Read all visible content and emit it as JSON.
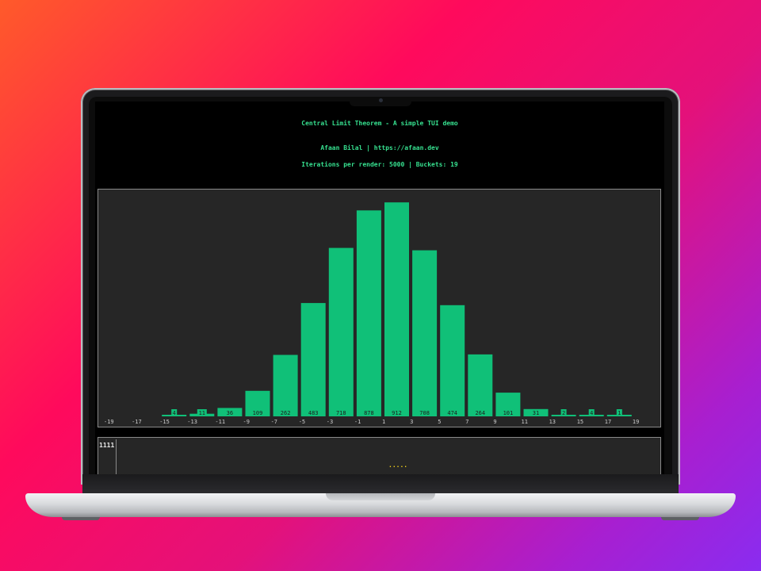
{
  "header": {
    "title": "Central Limit Theorem - A simple TUI demo",
    "author_line": "Afaan Bilal | https://afaan.dev",
    "stats_line": "Iterations per render: 5000 | Buckets: 19"
  },
  "chart_data": {
    "type": "bar",
    "categories": [
      "-19",
      "-17",
      "-15",
      "-13",
      "-11",
      "-9",
      "-7",
      "-5",
      "-3",
      "-1",
      "1",
      "3",
      "5",
      "7",
      "9",
      "11",
      "13",
      "15",
      "17",
      "19"
    ],
    "values": [
      0,
      0,
      4,
      11,
      36,
      109,
      262,
      483,
      718,
      878,
      912,
      708,
      474,
      264,
      101,
      31,
      2,
      4,
      1,
      0
    ],
    "value_labels": [
      "",
      "",
      "4",
      "11",
      "36",
      "109",
      "262",
      "483",
      "718",
      "878",
      "912",
      "708",
      "474",
      "264",
      "101",
      "31",
      "2",
      "4",
      "1",
      ""
    ],
    "axis_tick_labels": [
      "-19",
      "-17",
      "-15",
      "-13",
      "-11",
      "-9",
      "-7",
      "-5",
      "-3",
      "-1",
      "1",
      "3",
      "5",
      "7",
      "9",
      "11",
      "13",
      "15",
      "17",
      "19"
    ],
    "ylim": [
      0,
      950
    ],
    "bar_color": "#10c078",
    "label_color": "#1d1d1d",
    "axis_label_color": "#cfcfcf"
  },
  "log_panel": {
    "count": "1111",
    "sparkline": "....."
  },
  "colors": {
    "header_text": "#36e08f",
    "panel_bg": "#262626",
    "panel_border": "#8a8a8a",
    "sparkline": "#f5d21a"
  }
}
